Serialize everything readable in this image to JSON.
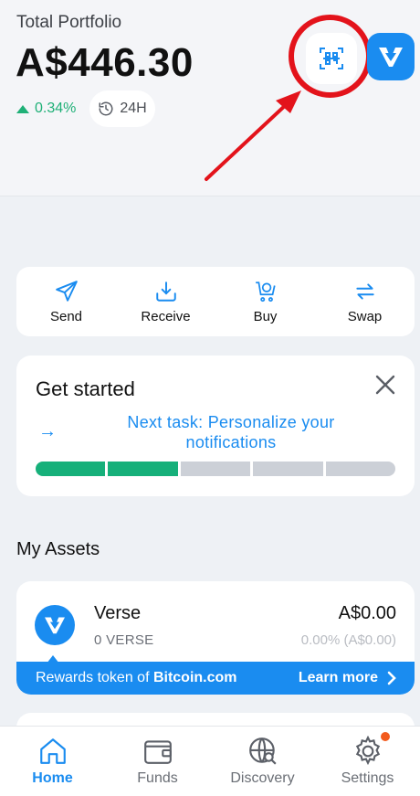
{
  "header": {
    "portfolio_label": "Total Portfolio",
    "portfolio_value": "A$446.30",
    "change_percent": "0.34%",
    "period": "24H"
  },
  "colors": {
    "accent": "#1a8cf0",
    "positive": "#16b07a",
    "highlight": "#e3131b"
  },
  "actions": [
    {
      "label": "Send",
      "icon": "send-icon"
    },
    {
      "label": "Receive",
      "icon": "receive-icon"
    },
    {
      "label": "Buy",
      "icon": "buy-cart-icon"
    },
    {
      "label": "Swap",
      "icon": "swap-icon"
    }
  ],
  "get_started": {
    "title": "Get started",
    "next_task": "Next task: Personalize your notifications",
    "progress_steps_done": 2,
    "progress_steps_total": 5
  },
  "assets": {
    "title": "My Assets",
    "items": [
      {
        "name": "Verse",
        "balance": "0 VERSE",
        "value": "A$0.00",
        "change": "0.00% (A$0.00)",
        "banner_text": "Rewards token of ",
        "banner_bold": "Bitcoin.com",
        "banner_link": "Learn more"
      }
    ]
  },
  "tabs": [
    {
      "label": "Home",
      "icon": "home-icon",
      "active": true
    },
    {
      "label": "Funds",
      "icon": "wallet-icon",
      "active": false
    },
    {
      "label": "Discovery",
      "icon": "globe-search-icon",
      "active": false
    },
    {
      "label": "Settings",
      "icon": "gear-icon",
      "active": false
    }
  ]
}
